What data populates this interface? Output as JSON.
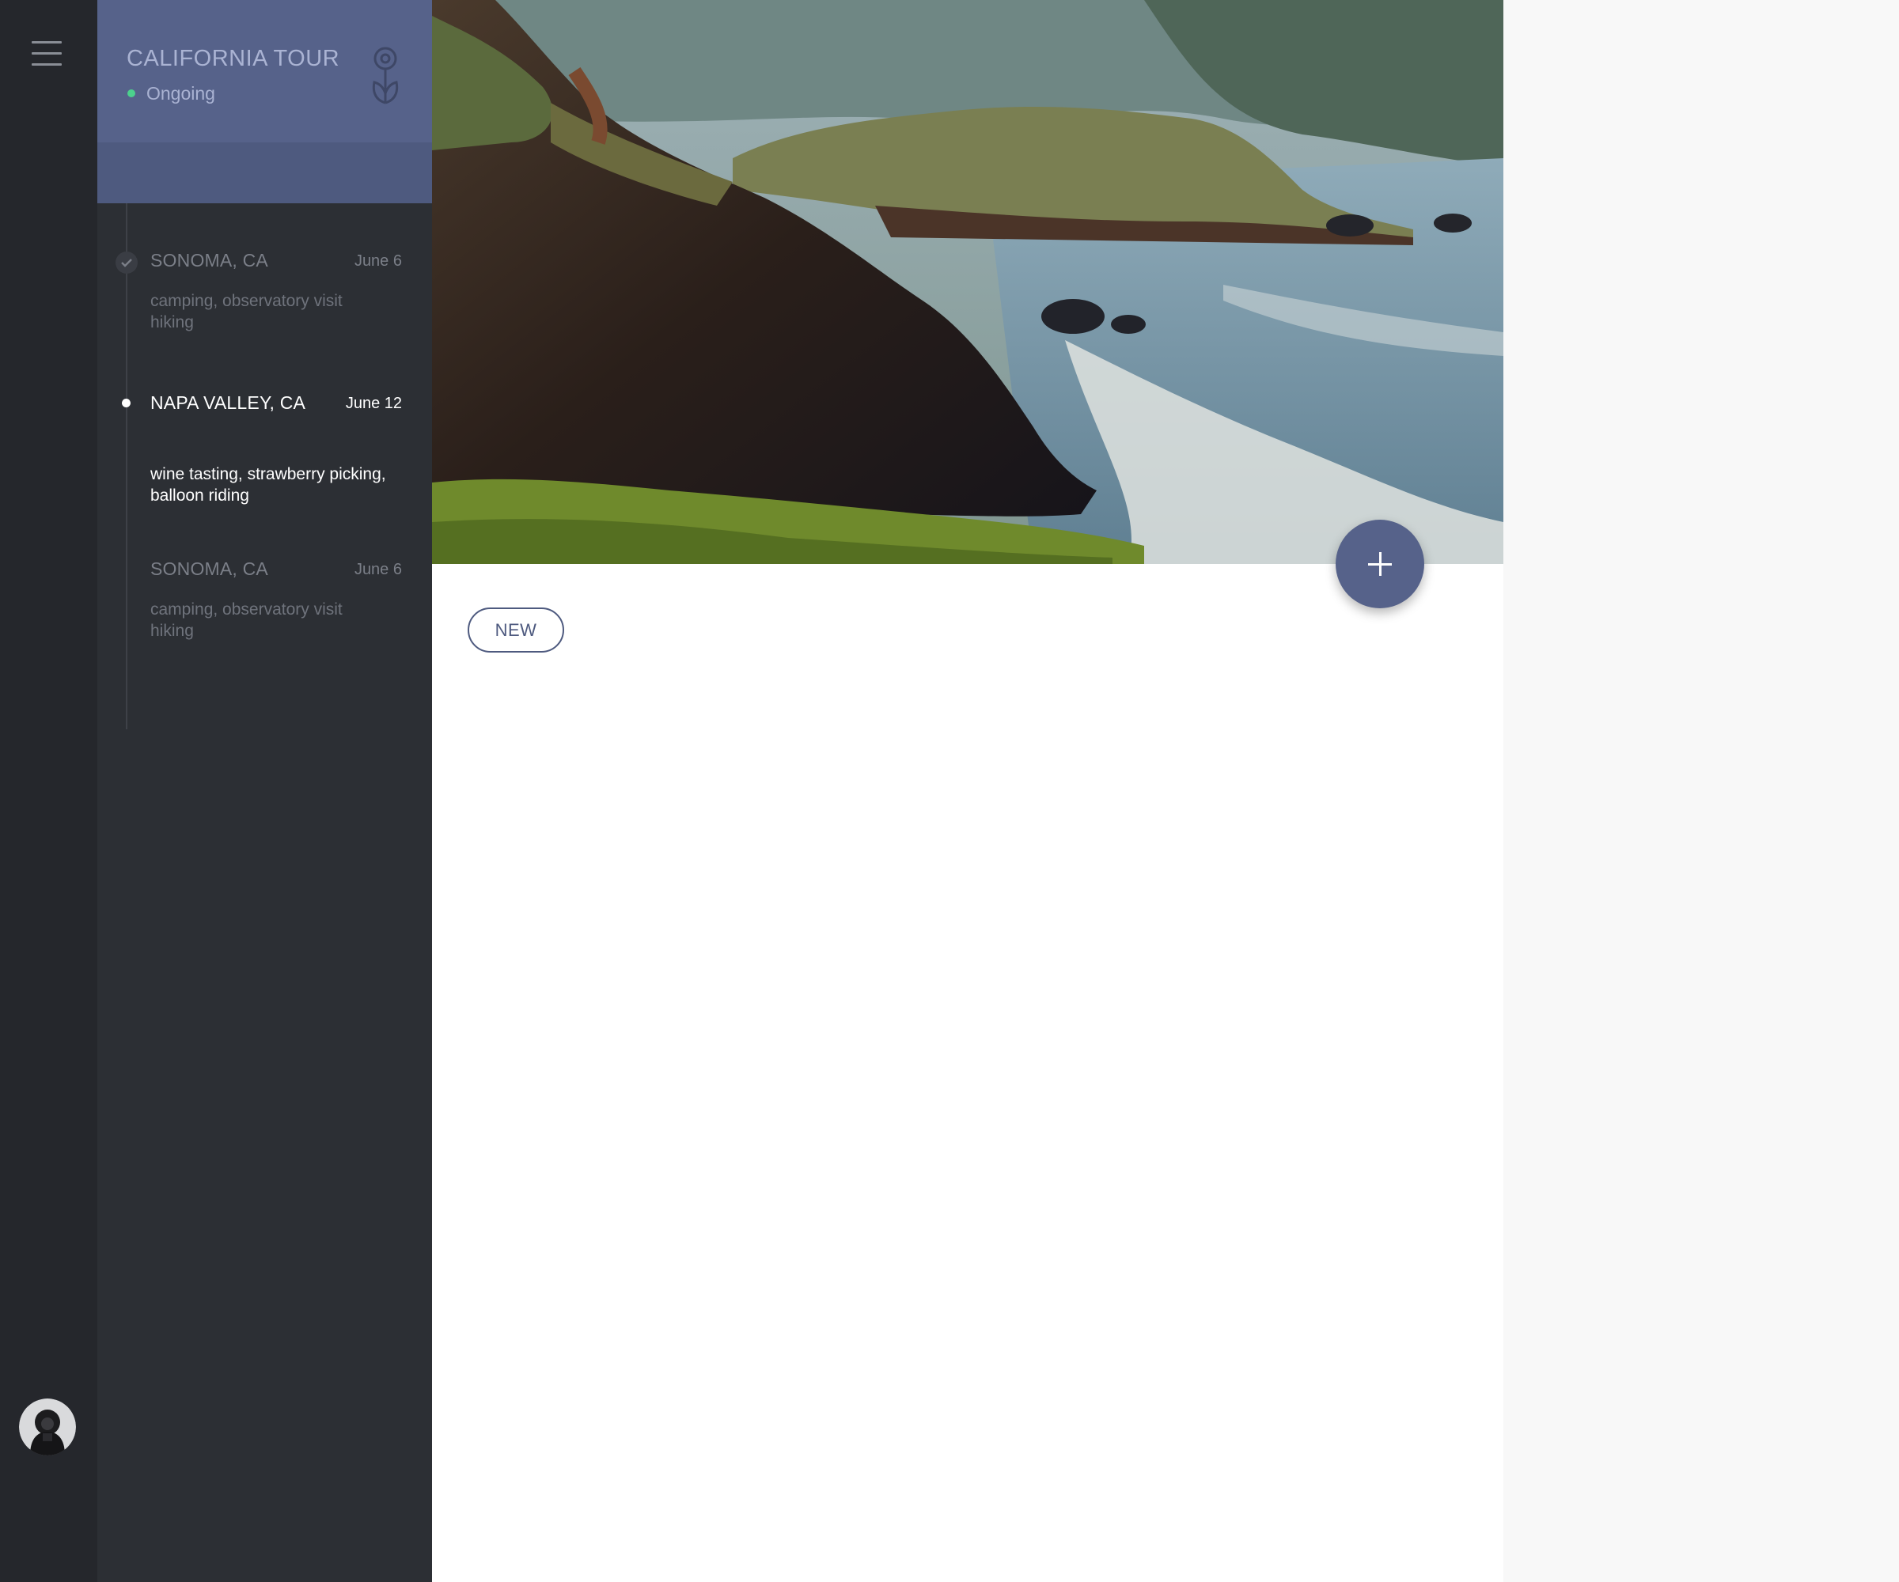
{
  "colors": {
    "rail": "#25272c",
    "panel": "#2c2f34",
    "header": "#56628a",
    "accent": "#4e5a7f",
    "status_ok": "#4cd18d"
  },
  "rail": {
    "menu_icon": "hamburger-menu-icon",
    "avatar_icon": "user-avatar"
  },
  "trip": {
    "title": "CALIFORNIA TOUR",
    "status": "Ongoing",
    "icon": "hot-air-balloon-icon"
  },
  "stops": [
    {
      "name": "SONOMA, CA",
      "date": "June 6",
      "desc": "camping, observatory visit hiking",
      "state": "completed"
    },
    {
      "name": "NAPA VALLEY, CA",
      "date": "June 12",
      "desc": "wine tasting, strawberry picking, balloon riding",
      "state": "active"
    },
    {
      "name": "SONOMA, CA",
      "date": "June 6",
      "desc": "camping, observatory visit hiking",
      "state": "upcoming"
    }
  ],
  "main": {
    "badge": "NEW",
    "fab_icon": "plus-icon"
  }
}
